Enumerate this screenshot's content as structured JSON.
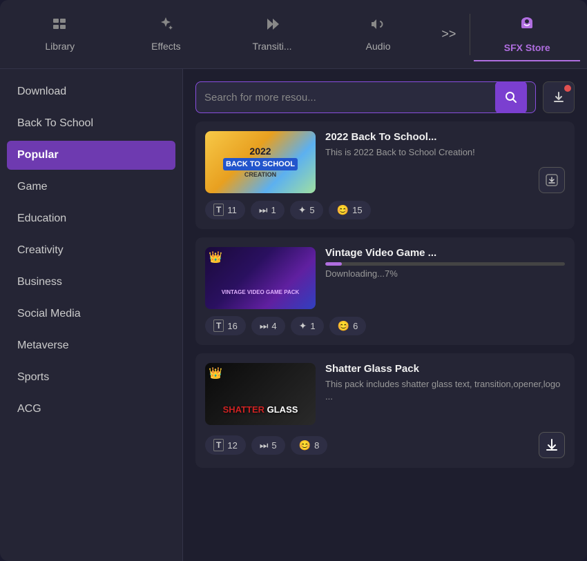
{
  "nav": {
    "items": [
      {
        "id": "library",
        "label": "Library",
        "icon": "🗂",
        "active": false
      },
      {
        "id": "effects",
        "label": "Effects",
        "icon": "✨",
        "active": false
      },
      {
        "id": "transitions",
        "label": "Transiti...",
        "icon": "⏭",
        "active": false
      },
      {
        "id": "audio",
        "label": "Audio",
        "icon": "🎵",
        "active": false
      },
      {
        "id": "sfx-store",
        "label": "SFX Store",
        "icon": "🛍",
        "active": true
      }
    ],
    "more_label": ">>"
  },
  "search": {
    "placeholder": "Search for more resou..."
  },
  "sidebar": {
    "items": [
      {
        "id": "download",
        "label": "Download",
        "active": false
      },
      {
        "id": "back-to-school",
        "label": "Back To School",
        "active": false
      },
      {
        "id": "popular",
        "label": "Popular",
        "active": true
      },
      {
        "id": "game",
        "label": "Game",
        "active": false
      },
      {
        "id": "education",
        "label": "Education",
        "active": false
      },
      {
        "id": "creativity",
        "label": "Creativity",
        "active": false
      },
      {
        "id": "business",
        "label": "Business",
        "active": false
      },
      {
        "id": "social-media",
        "label": "Social Media",
        "active": false
      },
      {
        "id": "metaverse",
        "label": "Metaverse",
        "active": false
      },
      {
        "id": "sports",
        "label": "Sports",
        "active": false
      },
      {
        "id": "acg",
        "label": "ACG",
        "active": false
      }
    ]
  },
  "cards": [
    {
      "id": "card-1",
      "title": "2022 Back To School...",
      "description": "This is 2022 Back to School Creation!",
      "stats": [
        {
          "icon": "T",
          "value": "11",
          "type": "text"
        },
        {
          "icon": "▶",
          "value": "1",
          "type": "transition"
        },
        {
          "icon": "✦",
          "value": "5",
          "type": "effect"
        },
        {
          "icon": "😊",
          "value": "15",
          "type": "emoji"
        }
      ],
      "has_download_icon": true,
      "download_style": "outline",
      "thumb_type": "bts",
      "progress": null
    },
    {
      "id": "card-2",
      "title": "Vintage Video Game ...",
      "description": "Downloading...7%",
      "stats": [
        {
          "icon": "T",
          "value": "16",
          "type": "text"
        },
        {
          "icon": "▶",
          "value": "4",
          "type": "transition"
        },
        {
          "icon": "✦",
          "value": "1",
          "type": "effect"
        },
        {
          "icon": "😊",
          "value": "6",
          "type": "emoji"
        }
      ],
      "has_download_icon": false,
      "download_style": null,
      "thumb_type": "vvg",
      "progress": 7
    },
    {
      "id": "card-3",
      "title": "Shatter Glass Pack",
      "description": "This pack includes shatter glass text, transition,opener,logo ...",
      "stats": [
        {
          "icon": "T",
          "value": "12",
          "type": "text"
        },
        {
          "icon": "▶",
          "value": "5",
          "type": "transition"
        },
        {
          "icon": "😊",
          "value": "8",
          "type": "emoji"
        }
      ],
      "has_download_icon": true,
      "download_style": "filled",
      "thumb_type": "sg",
      "progress": null
    }
  ],
  "colors": {
    "accent": "#b06ee0",
    "active_nav": "#b06ee0",
    "active_sidebar": "#6e3ab0",
    "progress_fill": "#b06ee0",
    "notif_dot": "#e05050"
  }
}
